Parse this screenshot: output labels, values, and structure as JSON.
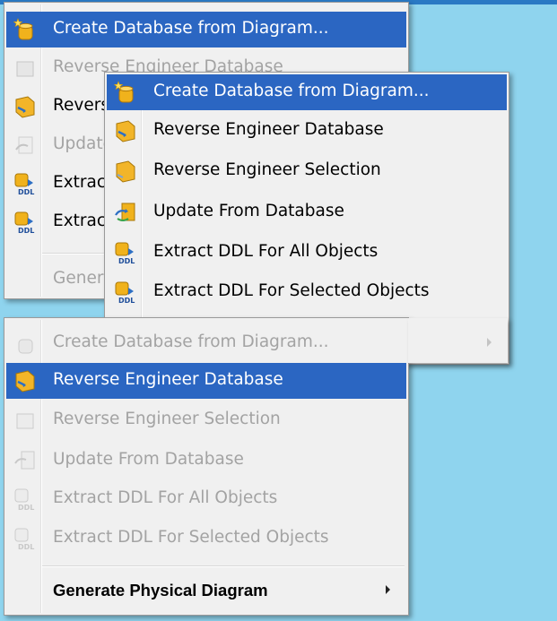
{
  "colors": {
    "desktop": "#8fd4ee",
    "highlight": "#2b66c2",
    "menu_bg": "#f0f0f0",
    "disabled_text": "#a3a3a3"
  },
  "menu_back": {
    "items": [
      {
        "label": "Create Database from Diagram...",
        "icon": "database-star-icon",
        "state": "selected"
      },
      {
        "label": "Reverse Engineer Database",
        "icon": "database-reverse-icon",
        "state": "disabled"
      },
      {
        "label": "Reverse Engineer Database",
        "icon": "database-reverse-icon",
        "state": "enabled"
      },
      {
        "label": "Update From Database",
        "icon": "update-arrows-icon",
        "state": "disabled"
      },
      {
        "label": "Extract DDL For All Objects",
        "icon": "ddl-extract-icon",
        "state": "enabled"
      },
      {
        "label": "Extract DDL For Selected Objects",
        "icon": "ddl-extract-icon",
        "state": "enabled"
      },
      {
        "label": "Generate Physical Diagram",
        "state": "disabled",
        "submenu": true
      }
    ]
  },
  "menu_front": {
    "items": [
      {
        "label": "Create Database from Diagram...",
        "icon": "database-star-icon",
        "state": "selected"
      },
      {
        "label": "Reverse Engineer Database",
        "icon": "database-reverse-icon",
        "state": "enabled"
      },
      {
        "label": "Reverse Engineer Selection",
        "icon": "database-selection-icon",
        "state": "enabled"
      },
      {
        "label": "Update From Database",
        "icon": "update-arrows-icon",
        "state": "enabled"
      },
      {
        "label": "Extract DDL For All Objects",
        "icon": "ddl-extract-icon",
        "state": "enabled"
      },
      {
        "label": "Extract DDL For Selected Objects",
        "icon": "ddl-extract-icon",
        "state": "enabled"
      }
    ]
  },
  "menu_bottom": {
    "items": [
      {
        "label": "Create Database from Diagram...",
        "icon": "database-star-icon",
        "state": "disabled"
      },
      {
        "label": "Reverse Engineer Database",
        "icon": "database-reverse-icon",
        "state": "selected"
      },
      {
        "label": "Reverse Engineer Selection",
        "icon": "database-selection-icon",
        "state": "disabled"
      },
      {
        "label": "Update From Database",
        "icon": "update-arrows-icon",
        "state": "disabled"
      },
      {
        "label": "Extract DDL For All Objects",
        "icon": "ddl-extract-icon",
        "state": "disabled"
      },
      {
        "label": "Extract DDL For Selected Objects",
        "icon": "ddl-extract-icon",
        "state": "disabled"
      },
      {
        "label": "Generate Physical Diagram",
        "state": "enabled",
        "submenu": true
      }
    ]
  }
}
